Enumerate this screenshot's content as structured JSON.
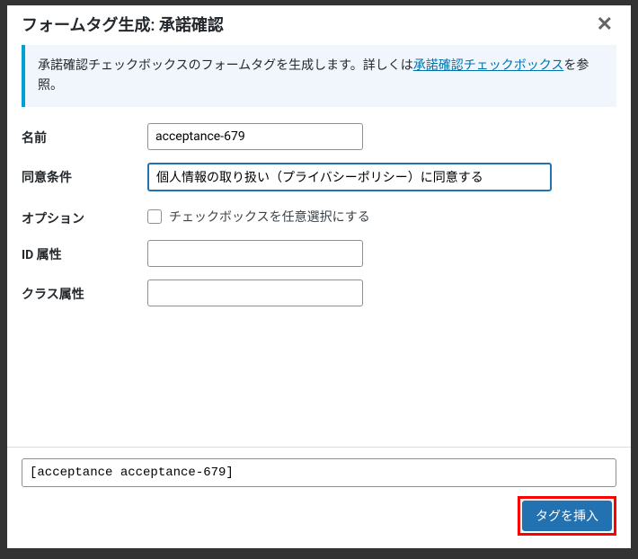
{
  "header": {
    "title": "フォームタグ生成: 承諾確認"
  },
  "info": {
    "prefix": "承諾確認チェックボックスのフォームタグを生成します。詳しくは",
    "link": "承諾確認チェックボックス",
    "suffix": "を参照。"
  },
  "fields": {
    "name": {
      "label": "名前",
      "value": "acceptance-679"
    },
    "condition": {
      "label": "同意条件",
      "value": "個人情報の取り扱い（プライバシーポリシー）に同意する"
    },
    "options": {
      "label": "オプション",
      "checkbox_label": "チェックボックスを任意選択にする"
    },
    "id_attr": {
      "label": "ID 属性",
      "value": ""
    },
    "class_attr": {
      "label": "クラス属性",
      "value": ""
    }
  },
  "footer": {
    "tag_output": "[acceptance acceptance-679]",
    "insert_label": "タグを挿入"
  }
}
